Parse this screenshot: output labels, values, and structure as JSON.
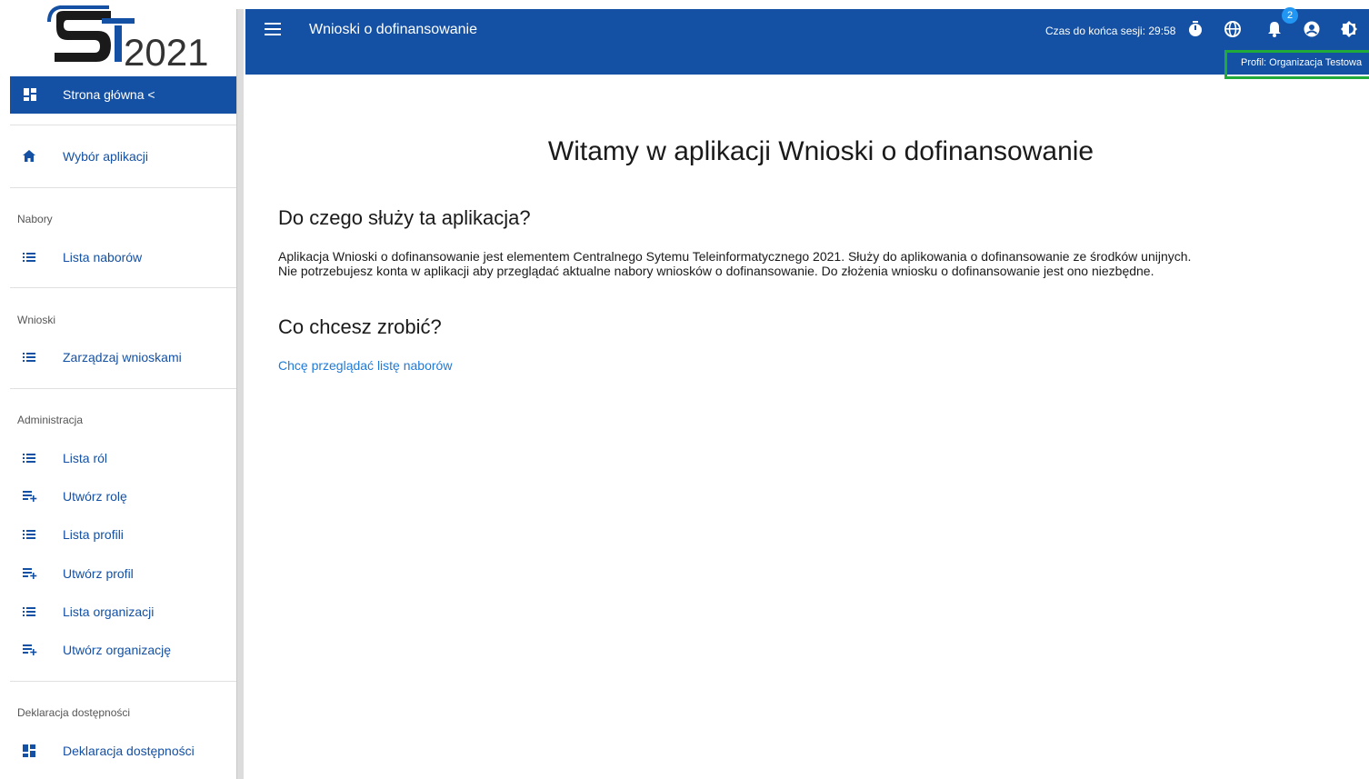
{
  "logo": {
    "text": "2021"
  },
  "sidebar": {
    "home_label": "Strona główna",
    "home_chevron": "<",
    "items": [
      {
        "label": "Wybór aplikacji",
        "icon": "home-icon"
      },
      {
        "label": "Lista naborów",
        "icon": "list-icon"
      },
      {
        "label": "Zarządzaj wnioskami",
        "icon": "list-icon"
      },
      {
        "label": "Lista ról",
        "icon": "list-icon"
      },
      {
        "label": "Utwórz rolę",
        "icon": "playlist-add-icon"
      },
      {
        "label": "Lista profili",
        "icon": "list-icon"
      },
      {
        "label": "Utwórz profil",
        "icon": "playlist-add-icon"
      },
      {
        "label": "Lista organizacji",
        "icon": "list-icon"
      },
      {
        "label": "Utwórz organizację",
        "icon": "playlist-add-icon"
      },
      {
        "label": "Deklaracja dostępności",
        "icon": "dashboard-icon"
      }
    ],
    "sections": {
      "nabory": "Nabory",
      "wnioski": "Wnioski",
      "administracja": "Administracja",
      "deklaracja": "Deklaracja dostępności"
    }
  },
  "topbar": {
    "title": "Wnioski o dofinansowanie",
    "session": "Czas do końca sesji: 29:58",
    "notifications_count": "2",
    "profile": "Profil: Organizacja Testowa"
  },
  "main": {
    "welcome": "Witamy w aplikacji Wnioski o dofinansowanie",
    "section1_title": "Do czego służy ta aplikacja?",
    "section1_line1": "Aplikacja Wnioski o dofinansowanie jest elementem Centralnego Sytemu Teleinformatycznego 2021. Służy do aplikowania o dofinansowanie ze środków unijnych.",
    "section1_line2": "Nie potrzebujesz konta w aplikacji aby przeglądać aktualne nabory wniosków o dofinansowanie. Do złożenia wniosku o dofinansowanie jest ono niezbędne.",
    "section2_title": "Co chcesz zrobić?",
    "link": "Chcę przeglądać listę naborów"
  },
  "colors": {
    "primary": "#1450a3",
    "link": "#1e7ad8",
    "highlight": "#1faa3a",
    "badge": "#2196f3"
  }
}
